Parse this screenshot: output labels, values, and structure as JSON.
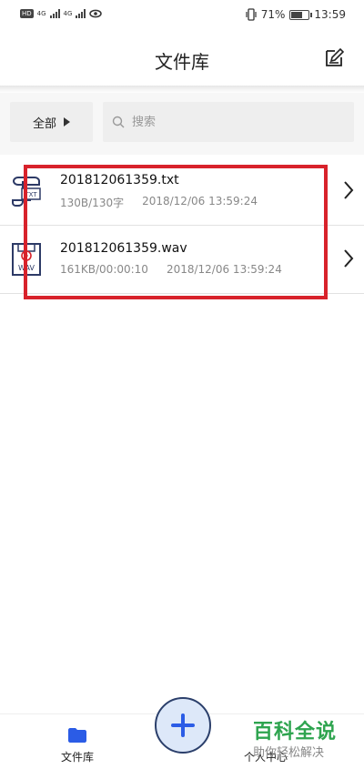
{
  "statusbar": {
    "left_badge": "HD",
    "net1": "4G",
    "net2": "4G",
    "battery_percent": "71%",
    "battery_level": 0.71,
    "time": "13:59"
  },
  "appbar": {
    "title": "文件库"
  },
  "filter": {
    "all_label": "全部",
    "search_placeholder": "搜索"
  },
  "files": [
    {
      "name": "201812061359.txt",
      "size": "130B/130字",
      "date": "2018/12/06 13:59:24",
      "type_label": "TXT"
    },
    {
      "name": "201812061359.wav",
      "size": "161KB/00:00:10",
      "date": "2018/12/06 13:59:24",
      "type_label": "WAV"
    }
  ],
  "bottomnav": {
    "files_tab": "文件库",
    "mine_tab": "个人中心"
  },
  "watermark": {
    "main": "百科全说",
    "sub": "助你轻松解决"
  },
  "colors": {
    "accent": "#2b5ce6",
    "highlight": "#d8222b",
    "watermark": "#2ea44f"
  }
}
